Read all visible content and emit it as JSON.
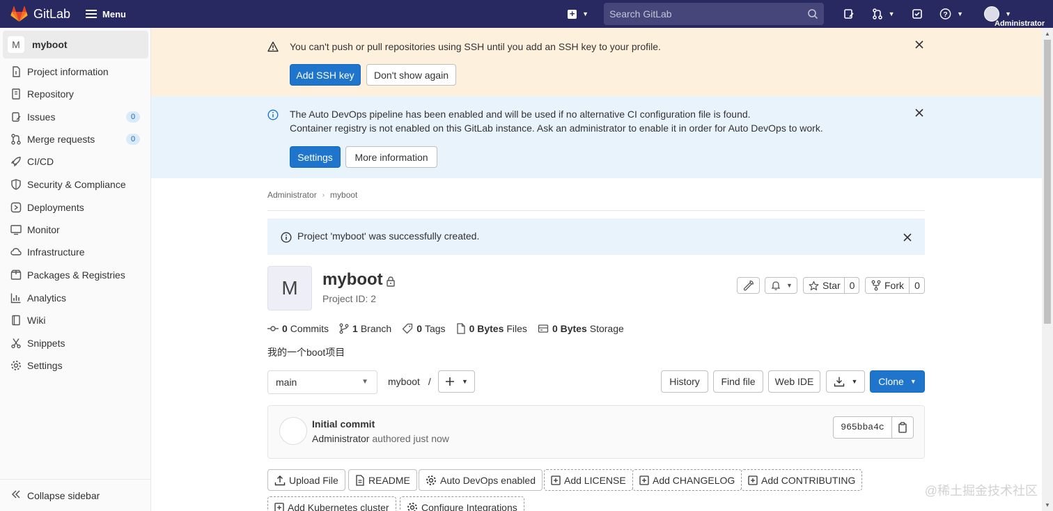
{
  "topbar": {
    "brand": "GitLab",
    "menu_label": "Menu",
    "search_placeholder": "Search GitLab",
    "user_name": "Administrator"
  },
  "sidebar": {
    "project_avatar": "M",
    "project_name": "myboot",
    "items": [
      {
        "label": "Project information",
        "icon": "info-icon"
      },
      {
        "label": "Repository",
        "icon": "document-icon"
      },
      {
        "label": "Issues",
        "icon": "issues-icon",
        "badge": "0"
      },
      {
        "label": "Merge requests",
        "icon": "merge-request-icon",
        "badge": "0"
      },
      {
        "label": "CI/CD",
        "icon": "rocket-icon"
      },
      {
        "label": "Security & Compliance",
        "icon": "shield-icon"
      },
      {
        "label": "Deployments",
        "icon": "deployments-icon"
      },
      {
        "label": "Monitor",
        "icon": "monitor-icon"
      },
      {
        "label": "Infrastructure",
        "icon": "cloud-icon"
      },
      {
        "label": "Packages & Registries",
        "icon": "package-icon"
      },
      {
        "label": "Analytics",
        "icon": "chart-icon"
      },
      {
        "label": "Wiki",
        "icon": "book-icon"
      },
      {
        "label": "Snippets",
        "icon": "scissors-icon"
      },
      {
        "label": "Settings",
        "icon": "gear-icon"
      }
    ],
    "collapse_label": "Collapse sidebar"
  },
  "ssh_alert": {
    "text": "You can't push or pull repositories using SSH until you add an SSH key to your profile.",
    "primary_label": "Add SSH key",
    "secondary_label": "Don't show again"
  },
  "devops_alert": {
    "line1": "The Auto DevOps pipeline has been enabled and will be used if no alternative CI configuration file is found.",
    "line2": "Container registry is not enabled on this GitLab instance. Ask an administrator to enable it in order for Auto DevOps to work.",
    "primary_label": "Settings",
    "secondary_label": "More information"
  },
  "breadcrumb": [
    "Administrator",
    "myboot"
  ],
  "flash": {
    "text": "Project 'myboot' was successfully created."
  },
  "project": {
    "avatar_letter": "M",
    "name": "myboot",
    "id_text": "Project ID: 2",
    "description": "我的一个boot项目",
    "star_label": "Star",
    "star_count": "0",
    "fork_label": "Fork",
    "fork_count": "0"
  },
  "stats": [
    {
      "value": "0",
      "label": "Commits"
    },
    {
      "value": "1",
      "label": "Branch"
    },
    {
      "value": "0",
      "label": "Tags"
    },
    {
      "value": "0 Bytes",
      "label": "Files"
    },
    {
      "value": "0 Bytes",
      "label": "Storage"
    }
  ],
  "repo_toolbar": {
    "branch": "main",
    "path": "myboot",
    "path_sep": "/",
    "history": "History",
    "find_file": "Find file",
    "web_ide": "Web IDE",
    "clone": "Clone"
  },
  "commit": {
    "title": "Initial commit",
    "author": "Administrator",
    "time": "authored just now",
    "sha": "965bba4c"
  },
  "quick_actions": [
    {
      "label": "Upload File",
      "style": "solid"
    },
    {
      "label": "README",
      "style": "solid"
    },
    {
      "label": "Auto DevOps enabled",
      "style": "solid"
    },
    {
      "label": "Add LICENSE",
      "style": "dashed"
    },
    {
      "label": "Add CHANGELOG",
      "style": "dashed"
    },
    {
      "label": "Add CONTRIBUTING",
      "style": "dashed"
    },
    {
      "label": "Add Kubernetes cluster",
      "style": "dashed"
    },
    {
      "label": "Configure Integrations",
      "style": "dashed"
    }
  ],
  "watermark": "@稀土掘金技术社区",
  "colors": {
    "navbar": "#292961",
    "primary": "#1f75cb",
    "warning_bg": "#fdf1dd",
    "info_bg": "#e9f3fc"
  }
}
